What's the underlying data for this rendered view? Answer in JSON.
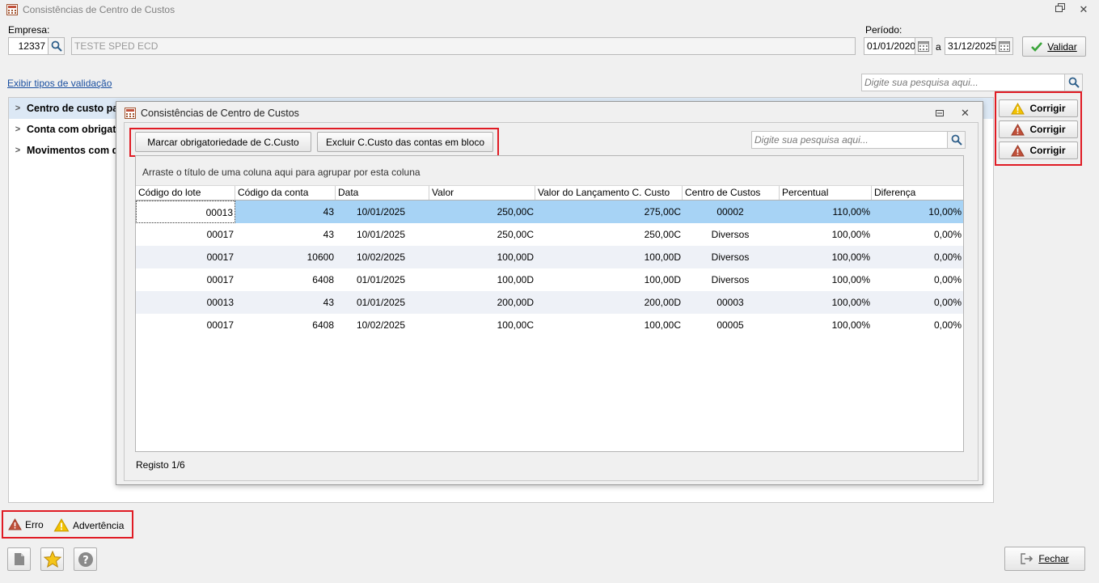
{
  "window": {
    "title": "Consistências de Centro de Custos"
  },
  "empresa": {
    "label": "Empresa:",
    "code": "12337",
    "name": "TESTE SPED ECD"
  },
  "periodo": {
    "label": "Período:",
    "start": "01/01/2020",
    "separator": "a",
    "end": "31/12/2025"
  },
  "validar_label": "Validar",
  "exibir_link": "Exibir tipos de validação",
  "search_placeholder": "Digite sua pesquisa aqui...",
  "tree_items": [
    {
      "label": "Centro de custo par"
    },
    {
      "label": "Conta com obrigato"
    },
    {
      "label": "Movimentos com di"
    }
  ],
  "corrigir_buttons": [
    {
      "label": "Corrigir",
      "severity": "warning"
    },
    {
      "label": "Corrigir",
      "severity": "error"
    },
    {
      "label": "Corrigir",
      "severity": "error"
    }
  ],
  "modal": {
    "title": "Consistências de Centro de Custos",
    "btn_marcar": "Marcar obrigatoriedade de C.Custo",
    "btn_excluir": "Excluir C.Custo das contas em bloco",
    "search_placeholder": "Digite sua pesquisa aqui...",
    "group_hint": "Arraste o título de uma coluna aqui para agrupar por esta coluna",
    "columns": [
      "Código do lote",
      "Código da conta",
      "Data",
      "Valor",
      "Valor do Lançamento C. Custo",
      "Centro de Custos",
      "Percentual",
      "Diferença"
    ],
    "rows": [
      [
        "00013",
        "43",
        "10/01/2025",
        "250,00C",
        "275,00C",
        "00002",
        "110,00%",
        "10,00%"
      ],
      [
        "00017",
        "43",
        "10/01/2025",
        "250,00C",
        "250,00C",
        "Diversos",
        "100,00%",
        "0,00%"
      ],
      [
        "00017",
        "10600",
        "10/02/2025",
        "100,00D",
        "100,00D",
        "Diversos",
        "100,00%",
        "0,00%"
      ],
      [
        "00017",
        "6408",
        "01/01/2025",
        "100,00D",
        "100,00D",
        "Diversos",
        "100,00%",
        "0,00%"
      ],
      [
        "00013",
        "43",
        "01/01/2025",
        "200,00D",
        "200,00D",
        "00003",
        "100,00%",
        "0,00%"
      ],
      [
        "00017",
        "6408",
        "10/02/2025",
        "100,00C",
        "100,00C",
        "00005",
        "100,00%",
        "0,00%"
      ]
    ],
    "status": "Registo 1/6"
  },
  "legend": {
    "erro": "Erro",
    "advertencia": "Advertência"
  },
  "fechar_label": "Fechar",
  "colors": {
    "selected_row": "#a7d3f5",
    "alt_row": "#eef1f7",
    "highlight_border": "#e01b24",
    "link": "#1a4fa0",
    "warning": "#f2c200",
    "error": "#c0503a"
  },
  "icons": {
    "app": "calculator-icon",
    "search": "magnifier-icon",
    "calendar": "calendar-icon",
    "validar": "checkmark-icon",
    "warning": "warning-triangle-icon",
    "error": "error-triangle-icon",
    "new": "document-icon",
    "favorite": "star-icon",
    "help": "help-icon",
    "exit": "exit-icon"
  }
}
